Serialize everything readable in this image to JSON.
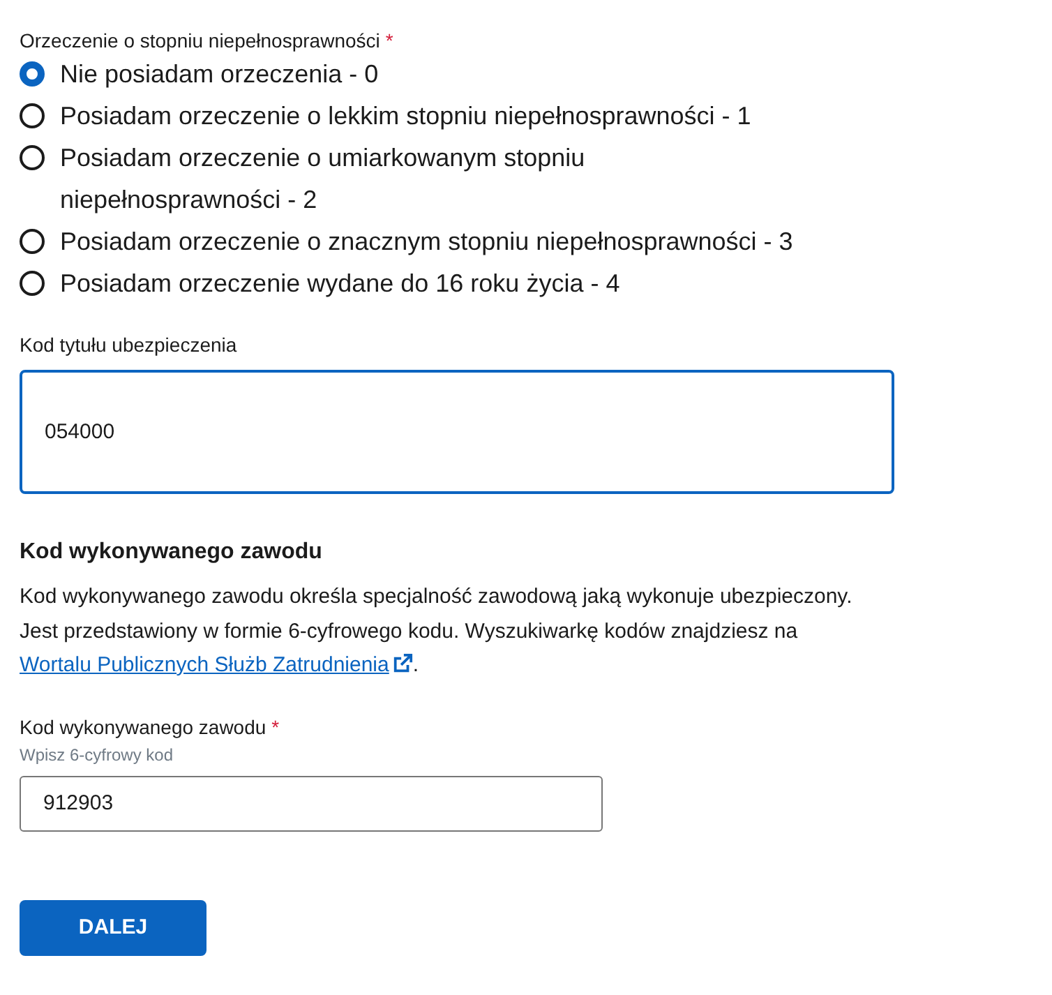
{
  "disability": {
    "label": "Orzeczenie o stopniu niepełnosprawności",
    "required_mark": "*",
    "options": [
      {
        "label": "Nie posiadam orzeczenia - 0",
        "selected": true
      },
      {
        "label": "Posiadam orzeczenie o lekkim stopniu niepełnosprawności - 1",
        "selected": false
      },
      {
        "label": "Posiadam orzeczenie o umiarkowanym stopniu\nniepełnosprawności - 2",
        "selected": false
      },
      {
        "label": "Posiadam orzeczenie o znacznym stopniu niepełnosprawności - 3",
        "selected": false
      },
      {
        "label": "Posiadam orzeczenie wydane do 16 roku życia - 4",
        "selected": false
      }
    ]
  },
  "insurance_code": {
    "label": "Kod tytułu ubezpieczenia",
    "value": "054000",
    "focused": true
  },
  "occupation": {
    "heading": "Kod wykonywanego zawodu",
    "description_before": "Kod wykonywanego zawodu określa specjalność zawodową jaką wykonuje ubezpieczony. Jest przedstawiony w formie 6-cyfrowego kodu. Wyszukiwarkę kodów znajdziesz na",
    "link": "Wortalu Publicznych Służb Zatrudnienia",
    "description_after": ".",
    "field": {
      "label": "Kod wykonywanego zawodu",
      "required_mark": "*",
      "hint": "Wpisz 6-cyfrowy kod",
      "value": "912903",
      "focused": false
    }
  },
  "buttons": [
    {
      "label": "DALEJ"
    }
  ]
}
